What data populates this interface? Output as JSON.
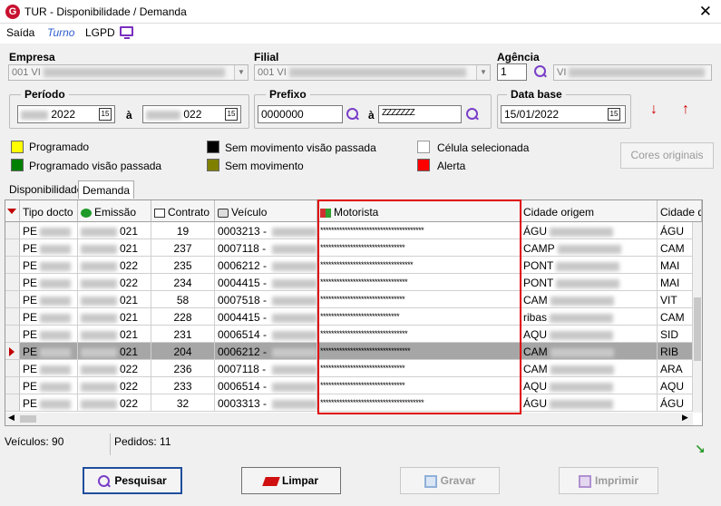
{
  "window": {
    "title": "TUR - Disponibilidade / Demanda",
    "close": "✕"
  },
  "menu": {
    "saida": "Saída",
    "turno": "Turno",
    "lgpd": "LGPD"
  },
  "empresa": {
    "label": "Empresa",
    "value": "001 VI"
  },
  "filial": {
    "label": "Filial",
    "value": "001 VI"
  },
  "agencia": {
    "label": "Agência",
    "value": "1",
    "desc": "VI"
  },
  "periodo": {
    "label": "Período",
    "from": "2022",
    "sep": "à",
    "to": "022"
  },
  "prefixo": {
    "label": "Prefixo",
    "from": "0000000",
    "sep": "à",
    "to": "ZZZZZZZ"
  },
  "data_base": {
    "label": "Data base",
    "value": "15/01/2022"
  },
  "legend": [
    {
      "label": "Programado",
      "color": "#ffff00"
    },
    {
      "label": "Programado visão passada",
      "color": "#008000"
    },
    {
      "label": "Sem movimento visão passada",
      "color": "#000000"
    },
    {
      "label": "Sem movimento",
      "color": "#808000"
    },
    {
      "label": "Célula selecionada",
      "color": "#ffffff"
    },
    {
      "label": "Alerta",
      "color": "#ff0000"
    }
  ],
  "cores_originais": "Cores originais",
  "tabs": {
    "disponibilidade": "Disponibilidade",
    "demanda": "Demanda"
  },
  "grid": {
    "columns": [
      "Tipo docto",
      "Emissão",
      "Contrato",
      "Veículo",
      "Motorista",
      "Cidade origem",
      "Cidade de"
    ],
    "rows": [
      {
        "tipo": "PE",
        "emissao": "021",
        "contrato": "19",
        "veiculo": "0003213 - ",
        "motorista": "**************************************",
        "origem": "ÁGU",
        "destino": "ÁGU"
      },
      {
        "tipo": "PE",
        "emissao": "021",
        "contrato": "237",
        "veiculo": "0007118 - ",
        "motorista": "*******************************",
        "origem": "CAMP",
        "destino": "CAM"
      },
      {
        "tipo": "PE",
        "emissao": "022",
        "contrato": "235",
        "veiculo": "0006212 - ",
        "motorista": "**********************************",
        "origem": "PONT",
        "destino": "MAI"
      },
      {
        "tipo": "PE",
        "emissao": "022",
        "contrato": "234",
        "veiculo": "0004415 - ",
        "motorista": "********************************",
        "origem": "PONT",
        "destino": "MAI"
      },
      {
        "tipo": "PE",
        "emissao": "021",
        "contrato": "58",
        "veiculo": "0007518 - ",
        "motorista": "*******************************",
        "origem": "CAM",
        "destino": "VIT"
      },
      {
        "tipo": "PE",
        "emissao": "021",
        "contrato": "228",
        "veiculo": "0004415 - ",
        "motorista": "*****************************",
        "origem": "ribas",
        "destino": "CAM"
      },
      {
        "tipo": "PE",
        "emissao": "021",
        "contrato": "231",
        "veiculo": "0006514 - ",
        "motorista": "********************************",
        "origem": "AQU",
        "destino": "SID"
      },
      {
        "tipo": "PE",
        "emissao": "021",
        "contrato": "204",
        "veiculo": "0006212 - ",
        "motorista": "*********************************",
        "origem": "CAM",
        "destino": "RIB"
      },
      {
        "tipo": "PE",
        "emissao": "022",
        "contrato": "236",
        "veiculo": "0007118 - ",
        "motorista": "*******************************",
        "origem": "CAM",
        "destino": "ARA"
      },
      {
        "tipo": "PE",
        "emissao": "022",
        "contrato": "233",
        "veiculo": "0006514 - ",
        "motorista": "*******************************",
        "origem": "AQU",
        "destino": "AQU"
      },
      {
        "tipo": "PE",
        "emissao": "022",
        "contrato": "32",
        "veiculo": "0003313 - ",
        "motorista": "**************************************",
        "origem": "ÁGU",
        "destino": "ÁGU"
      }
    ]
  },
  "status": {
    "veiculos": "Veículos: 90",
    "pedidos": "Pedidos: 11"
  },
  "buttons": {
    "pesquisar": "Pesquisar",
    "limpar": "Limpar",
    "gravar": "Gravar",
    "imprimir": "Imprimir"
  }
}
